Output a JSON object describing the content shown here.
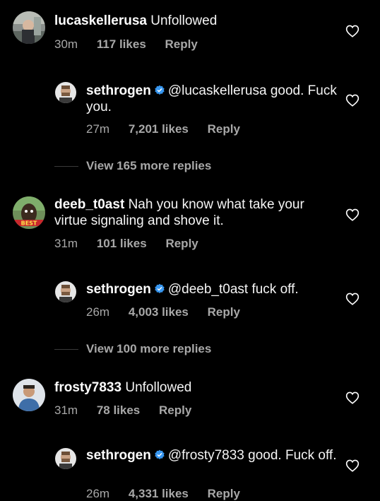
{
  "colors": {
    "background": "#000000",
    "text": "#ffffff",
    "secondary": "#a8a8a8",
    "verified": "#3897f0"
  },
  "comments": [
    {
      "username": "lucaskellerusa",
      "verified": false,
      "text": "Unfollowed",
      "time": "30m",
      "likes": "117 likes",
      "reply": "Reply"
    },
    {
      "username": "sethrogen",
      "verified": true,
      "text": "@lucaskellerusa good. Fuck you.",
      "time": "27m",
      "likes": "7,201 likes",
      "reply": "Reply"
    },
    {
      "username": "deeb_t0ast",
      "verified": false,
      "text": "Nah you know what take your virtue signaling and shove it.",
      "time": "31m",
      "likes": "101 likes",
      "reply": "Reply",
      "avatar_text": "BEST"
    },
    {
      "username": "sethrogen",
      "verified": true,
      "text": "@deeb_t0ast fuck off.",
      "time": "26m",
      "likes": "4,003 likes",
      "reply": "Reply"
    },
    {
      "username": "frosty7833",
      "verified": false,
      "text": "Unfollowed",
      "time": "31m",
      "likes": "78 likes",
      "reply": "Reply"
    },
    {
      "username": "sethrogen",
      "verified": true,
      "text": "@frosty7833 good. Fuck off.",
      "time": "26m",
      "likes": "4,331 likes",
      "reply": "Reply"
    }
  ],
  "view_more": [
    {
      "label": "View 165 more replies"
    },
    {
      "label": "View 100 more replies"
    }
  ],
  "icons": {
    "like": "heart-outline-icon",
    "verified": "verified-badge-icon"
  }
}
